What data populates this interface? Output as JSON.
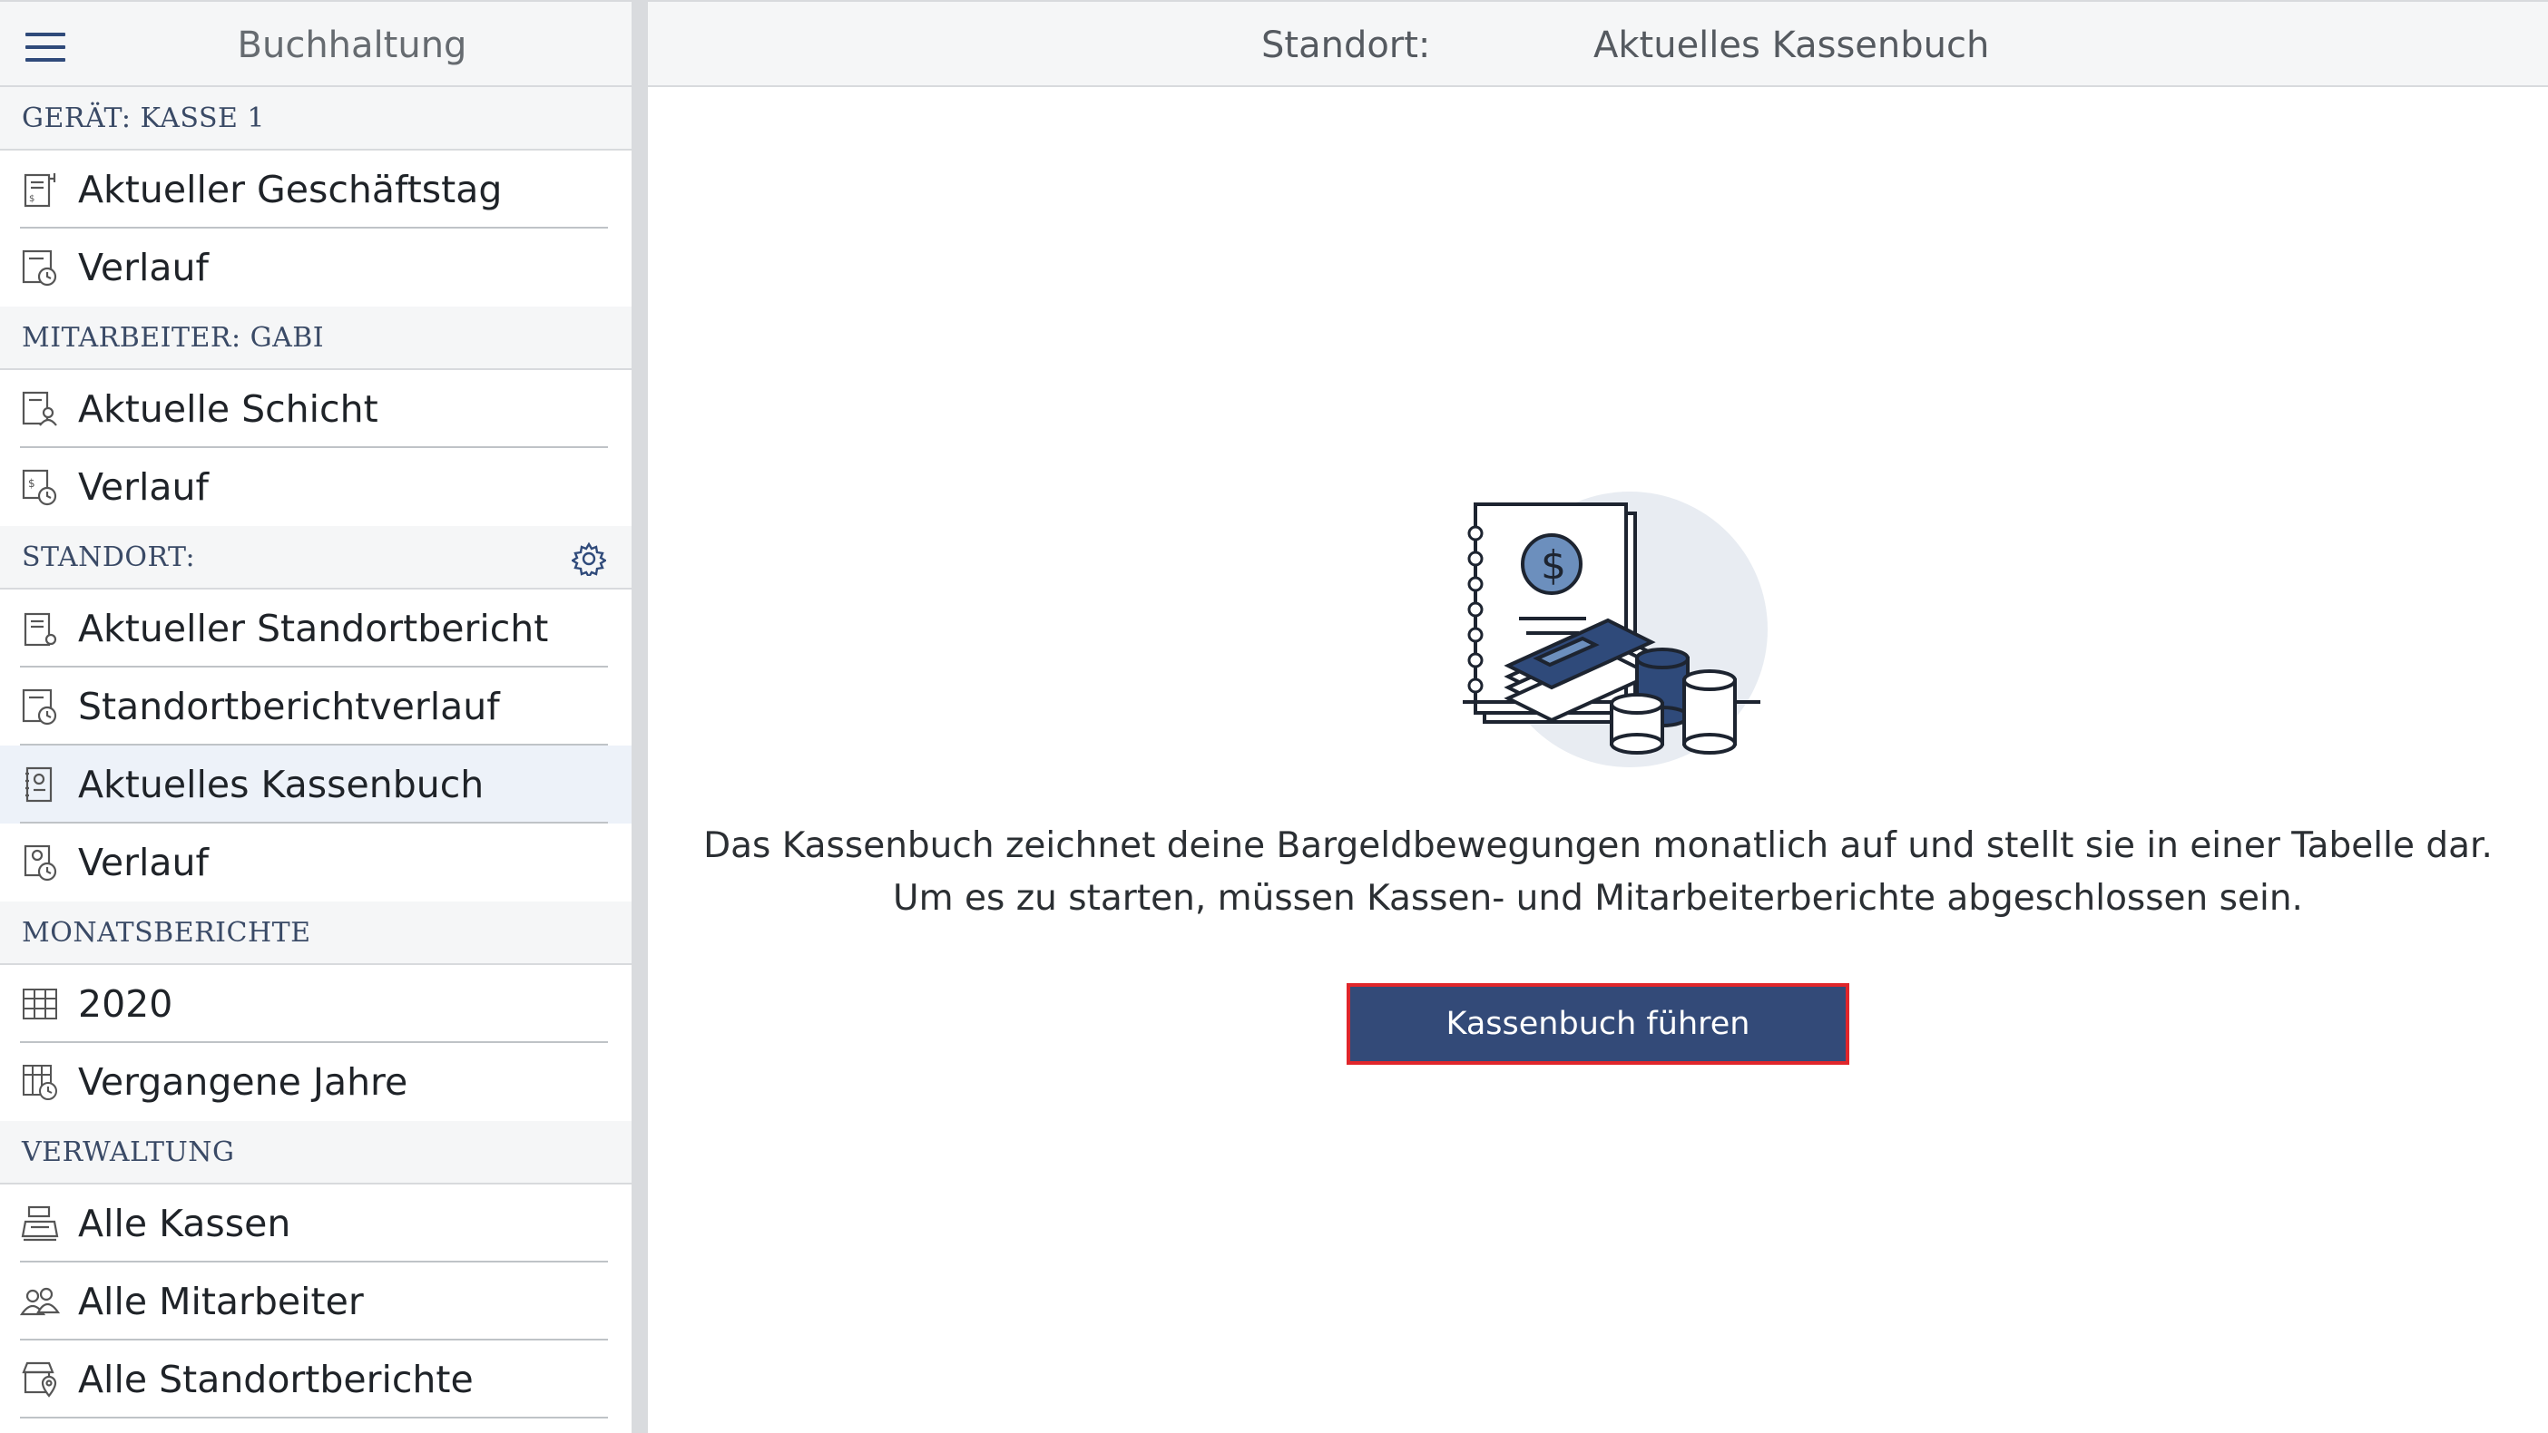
{
  "sidebar": {
    "title": "Buchhaltung",
    "sections": [
      {
        "label": "GERÄT: KASSE 1"
      },
      {
        "label": "MITARBEITER: GABI"
      },
      {
        "label": "STANDORT:"
      },
      {
        "label": "MONATSBERICHTE"
      },
      {
        "label": "VERWALTUNG"
      }
    ],
    "items": [
      {
        "label": "Aktueller Geschäftstag",
        "icon": "receipt-icon"
      },
      {
        "label": "Verlauf",
        "icon": "receipt-history-icon"
      },
      {
        "label": "Aktuelle Schicht",
        "icon": "employee-report-icon"
      },
      {
        "label": "Verlauf",
        "icon": "employee-history-icon"
      },
      {
        "label": "Aktueller Standortbericht",
        "icon": "location-report-icon"
      },
      {
        "label": "Standortberichtverlauf",
        "icon": "location-history-icon"
      },
      {
        "label": "Aktuelles Kassenbuch",
        "icon": "cashbook-icon",
        "active": true
      },
      {
        "label": "Verlauf",
        "icon": "cashbook-history-icon"
      },
      {
        "label": "2020",
        "icon": "calendar-grid-icon"
      },
      {
        "label": "Vergangene Jahre",
        "icon": "calendar-history-icon"
      },
      {
        "label": "Alle Kassen",
        "icon": "cash-register-icon"
      },
      {
        "label": "Alle Mitarbeiter",
        "icon": "users-icon"
      },
      {
        "label": "Alle Standortberichte",
        "icon": "store-location-icon"
      }
    ]
  },
  "header": {
    "location": "Standort:",
    "title": "Aktuelles Kassenbuch"
  },
  "main": {
    "description": "Das Kassenbuch zeichnet deine Bargeldbewegungen monatlich auf und stellt sie in einer Tabelle dar. Um es zu starten, müssen Kassen- und Mitarbeiterberichte abgeschlossen sein.",
    "button_label": "Kassenbuch führen"
  },
  "colors": {
    "accent": "#334a78",
    "highlight_border": "#e0262b",
    "active_item_bg": "#edf2f9",
    "section_bg": "#f5f6f7"
  }
}
